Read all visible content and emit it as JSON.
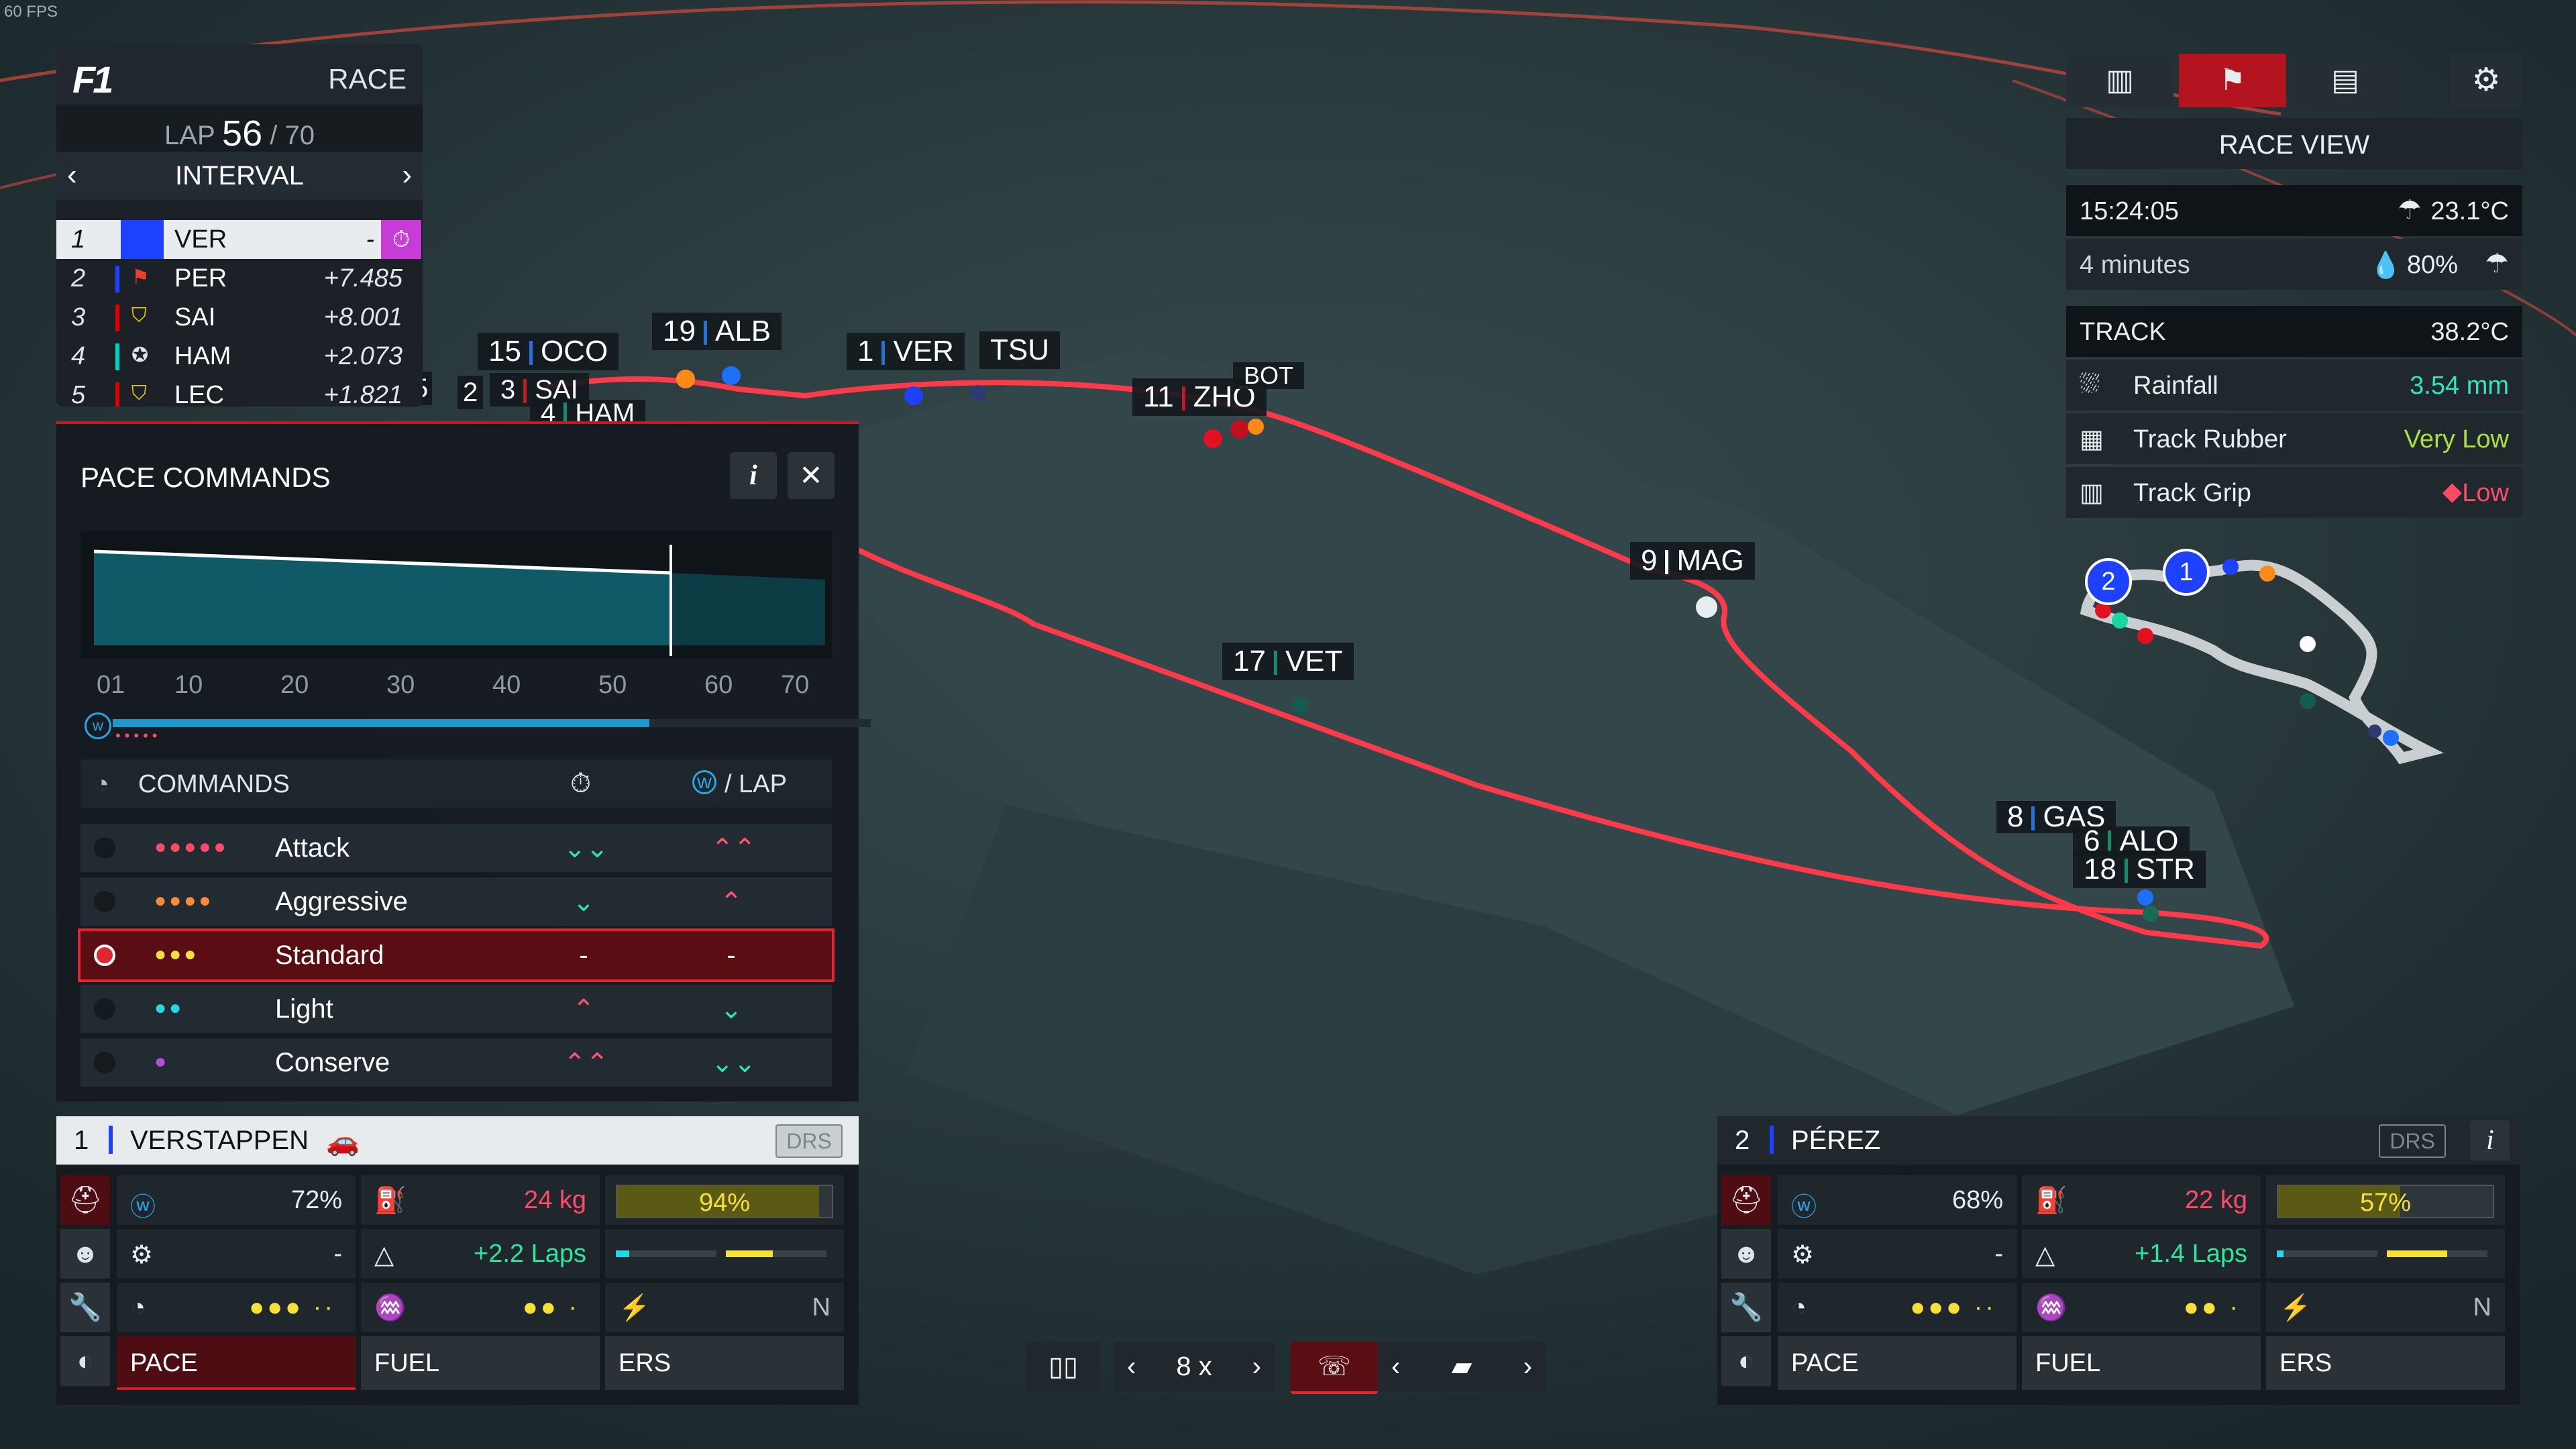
{
  "fps": "60 FPS",
  "race": {
    "label": "RACE",
    "lap_label": "LAP",
    "lap_current": "56",
    "lap_total": "/ 70",
    "interval_label": "INTERVAL"
  },
  "standings": [
    {
      "pos": "1",
      "name": "VER",
      "gap": "-",
      "team_color": "#1e41ff"
    },
    {
      "pos": "2",
      "name": "PER",
      "gap": "+7.485",
      "team_color": "#1e41ff"
    },
    {
      "pos": "3",
      "name": "SAI",
      "gap": "+8.001",
      "team_color": "#dc0000"
    },
    {
      "pos": "4",
      "name": "HAM",
      "gap": "+2.073",
      "team_color": "#00d2be"
    },
    {
      "pos": "5",
      "name": "LEC",
      "gap": "+1.821",
      "team_color": "#dc0000"
    }
  ],
  "pace": {
    "title": "PACE COMMANDS",
    "info_icon": "i",
    "close_icon": "✕",
    "axis_ticks": [
      "01",
      "10",
      "20",
      "30",
      "40",
      "50",
      "60",
      "70"
    ],
    "commands_header": "COMMANDS",
    "lap_header": "/ LAP",
    "commands": [
      {
        "label": "Attack",
        "dots": "●●●●●",
        "dot_color": "#ff4a6a",
        "c1": "⌄⌄",
        "c1_color": "#2ee6a0",
        "c2": "⌃⌃",
        "c2_color": "#ff5570"
      },
      {
        "label": "Aggressive",
        "dots": "●●●●",
        "dot_color": "#ff8a3a",
        "c1": "⌄",
        "c1_color": "#2ee6a0",
        "c2": "⌃",
        "c2_color": "#ff5570"
      },
      {
        "label": "Standard",
        "dots": "●●●",
        "dot_color": "#f5e13a",
        "c1": "-",
        "c1_color": "#ffffff",
        "c2": "-",
        "c2_color": "#ffffff"
      },
      {
        "label": "Light",
        "dots": "●●",
        "dot_color": "#27d7e6",
        "c1": "⌃",
        "c1_color": "#ff5570",
        "c2": "⌄",
        "c2_color": "#2ee6a0"
      },
      {
        "label": "Conserve",
        "dots": "●",
        "dot_color": "#b44de0",
        "c1": "⌃⌃",
        "c1_color": "#ff5570",
        "c2": "⌄⌄",
        "c2_color": "#2ee6a0"
      }
    ]
  },
  "driver_left": {
    "pos": "1",
    "name": "VERSTAPPEN",
    "drs": "DRS",
    "ers_pct": "72%",
    "fuel_kg": "24 kg",
    "tyre_pct": "94%",
    "tyre_fill": 0.94,
    "wear": "-",
    "fuel_laps": "+2.2 Laps",
    "ers_mode": "N",
    "tabs": [
      "PACE",
      "FUEL",
      "ERS"
    ]
  },
  "driver_right": {
    "pos": "2",
    "name": "PÉREZ",
    "drs": "DRS",
    "ers_pct": "68%",
    "fuel_kg": "22 kg",
    "tyre_pct": "57%",
    "tyre_fill": 0.57,
    "wear": "-",
    "fuel_laps": "+1.4 Laps",
    "ers_mode": "N",
    "tabs": [
      "PACE",
      "FUEL",
      "ERS"
    ]
  },
  "race_view": {
    "title": "RACE VIEW",
    "time": "15:24:05",
    "air_temp": "23.1°C",
    "forecast": "4 minutes",
    "rain_chance": "80%",
    "track_label": "TRACK",
    "track_temp": "38.2°C",
    "rainfall_label": "Rainfall",
    "rainfall": "3.54 mm",
    "rubber_label": "Track Rubber",
    "rubber": "Very Low",
    "grip_label": "Track Grip",
    "grip": "Low"
  },
  "playback": {
    "speed": "8 x"
  },
  "map_tags": [
    {
      "pos": "15",
      "name": "OCO"
    },
    {
      "pos": "19",
      "name": "ALB"
    },
    {
      "pos": "1",
      "name": "VER"
    },
    {
      "pos": "",
      "name": "TSU"
    },
    {
      "pos": "11",
      "name": "ZHO"
    },
    {
      "pos": "",
      "name": "BOT"
    },
    {
      "pos": "9",
      "name": "MAG"
    },
    {
      "pos": "17",
      "name": "VET"
    },
    {
      "pos": "8",
      "name": "GAS"
    },
    {
      "pos": "6",
      "name": "ALO"
    },
    {
      "pos": "18",
      "name": "STR"
    },
    {
      "pos": "5",
      "name": ""
    },
    {
      "pos": "2",
      "name": ""
    },
    {
      "pos": "3",
      "name": "SAI"
    },
    {
      "pos": "4",
      "name": "HAM"
    }
  ],
  "minimap_markers": [
    "2",
    "1"
  ]
}
